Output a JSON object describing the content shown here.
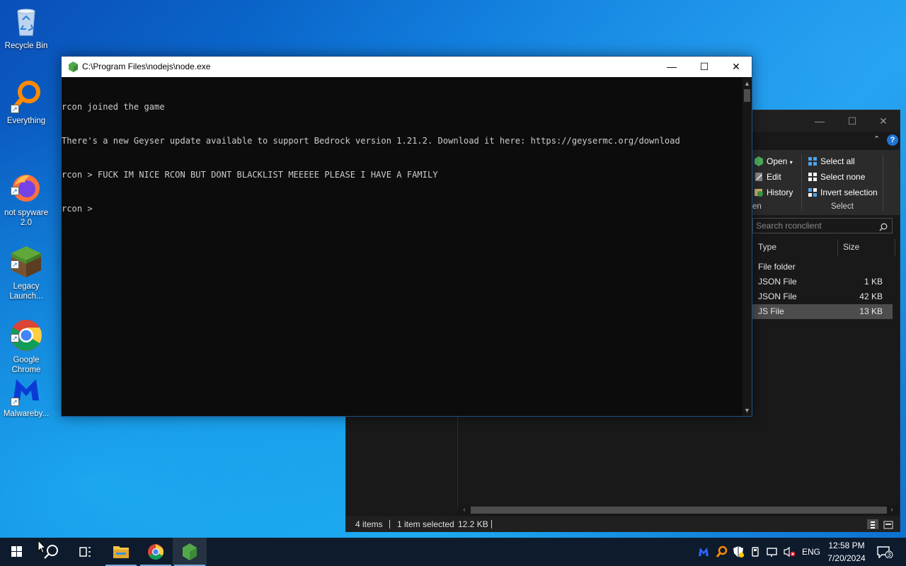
{
  "desktop": {
    "icons": [
      {
        "label": "Recycle Bin",
        "icon": "recycle-bin-icon"
      },
      {
        "label": "Everything",
        "icon": "everything-search-icon"
      },
      {
        "label": "not spyware\n2.0",
        "icon": "firefox-icon"
      },
      {
        "label": "Legacy\nLaunch...",
        "icon": "minecraft-grass-block-icon"
      },
      {
        "label": "Google\nChrome",
        "icon": "chrome-icon"
      },
      {
        "label": "Malwareby...",
        "icon": "malwarebytes-icon"
      }
    ]
  },
  "console": {
    "title": "C:\\Program Files\\nodejs\\node.exe",
    "lines": [
      "rcon joined the game",
      "There's a new Geyser update available to support Bedrock version 1.21.2. Download it here: https://geysermc.org/download",
      "rcon > FUCK IM NICE RCON BUT DONT BLACKLIST MEEEEE PLEASE I HAVE A FAMILY",
      "rcon > "
    ],
    "controls": {
      "minimize": "—",
      "maximize": "☐",
      "close": "✕"
    }
  },
  "explorer": {
    "controls": {
      "minimize": "—",
      "maximize": "☐",
      "close": "✕"
    },
    "ribbon": {
      "open_group": {
        "open": "Open",
        "edit": "Edit",
        "history": "History",
        "label": "en"
      },
      "select_group": {
        "select_all": "Select all",
        "select_none": "Select none",
        "invert_selection": "Invert selection",
        "label": "Select"
      }
    },
    "search_placeholder": "Search rconclient",
    "columns": {
      "type": "Type",
      "size": "Size"
    },
    "files": [
      {
        "type": "File folder",
        "size": ""
      },
      {
        "type": "JSON File",
        "size": "1 KB"
      },
      {
        "type": "JSON File",
        "size": "42 KB"
      },
      {
        "type": "JS File",
        "size": "13 KB",
        "selected": true
      }
    ],
    "status": {
      "items": "4 items",
      "selected": "1 item selected",
      "selected_size": "12.2 KB"
    }
  },
  "taskbar": {
    "tray": {
      "language": "ENG",
      "time": "12:58 PM",
      "date": "7/20/2024",
      "notifications": "3"
    }
  },
  "colors": {
    "console_bg": "#0c0c0c",
    "console_text": "#cccccc",
    "explorer_bg": "#191919",
    "taskbar_bg": "#0d1b2c",
    "desktop_accent": "#0b78d8"
  }
}
